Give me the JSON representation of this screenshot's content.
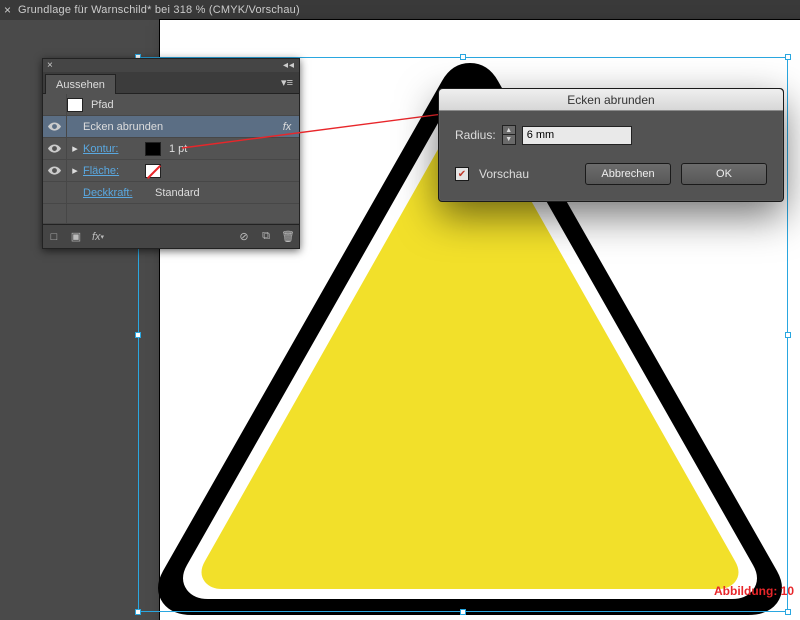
{
  "tab": {
    "title": "Grundlage für Warnschild* bei 318 % (CMYK/Vorschau)"
  },
  "panel": {
    "title": "Aussehen",
    "header_label": "Pfad",
    "rows": {
      "effect": {
        "label": "Ecken abrunden"
      },
      "stroke": {
        "label": "Kontur:",
        "value": "1 pt",
        "swatch": "#000000"
      },
      "fill": {
        "label": "Fläche:",
        "swatch_type": "none"
      },
      "opacity": {
        "label": "Deckkraft:",
        "value": "Standard"
      }
    }
  },
  "dialog": {
    "title": "Ecken abrunden",
    "radius_label": "Radius:",
    "radius_value": "6 mm",
    "preview_label": "Vorschau",
    "preview_checked": true,
    "cancel": "Abbrechen",
    "ok": "OK"
  },
  "caption": "Abbildung: 10",
  "colors": {
    "sign_yellow": "#f2e02a",
    "sign_black": "#000000",
    "accent_red": "#e8262a"
  }
}
